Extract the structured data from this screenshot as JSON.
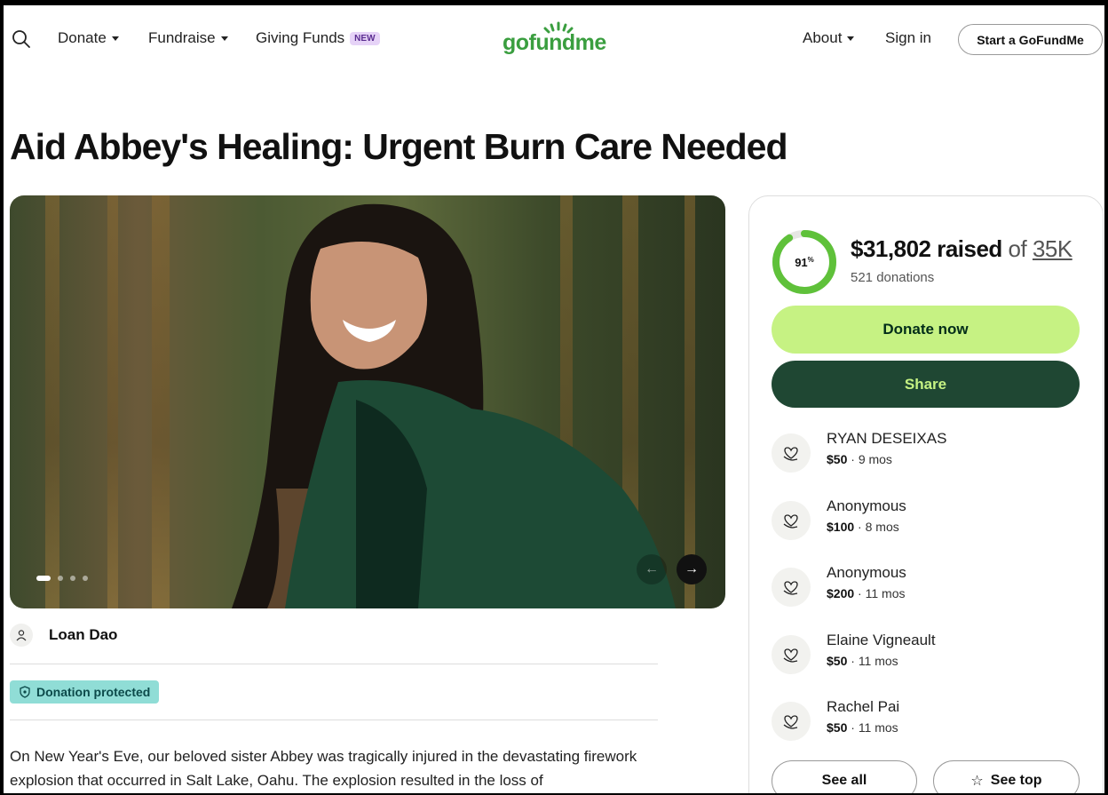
{
  "header": {
    "nav": [
      {
        "label": "Donate"
      },
      {
        "label": "Fundraise"
      },
      {
        "label": "Giving Funds",
        "badge": "NEW"
      }
    ],
    "logo_text": "gofundme",
    "about_label": "About",
    "signin_label": "Sign in",
    "start_label": "Start a GoFundMe"
  },
  "campaign": {
    "title": "Aid Abbey's Healing: Urgent Burn Care Needed",
    "organizer": "Loan Dao",
    "protected_label": "Donation protected",
    "story": "On New Year's Eve, our beloved sister Abbey was tragically injured in the devastating firework explosion that occurred in Salt Lake, Oahu. The explosion resulted in the loss of",
    "image_slides": 4,
    "active_slide": 1
  },
  "progress": {
    "percent": 91,
    "percent_label": "91",
    "percent_sign": "%",
    "raised": "$31,802 raised",
    "of_label": "of",
    "goal": "35K",
    "donations": "521 donations"
  },
  "actions": {
    "donate_label": "Donate now",
    "share_label": "Share",
    "see_all_label": "See all",
    "see_top_label": "See top"
  },
  "donors": [
    {
      "name": "RYAN DESEIXAS",
      "amount": "$50",
      "time": "9 mos"
    },
    {
      "name": "Anonymous",
      "amount": "$100",
      "time": "8 mos"
    },
    {
      "name": "Anonymous",
      "amount": "$200",
      "time": "11 mos"
    },
    {
      "name": "Elaine Vigneault",
      "amount": "$50",
      "time": "11 mos"
    },
    {
      "name": "Rachel Pai",
      "amount": "$50",
      "time": "11 mos"
    }
  ],
  "colors": {
    "brand_green": "#3a9e3f",
    "donate_bg": "#c6f283",
    "share_bg": "#1f4733",
    "protected_bg": "#90ddd6"
  }
}
